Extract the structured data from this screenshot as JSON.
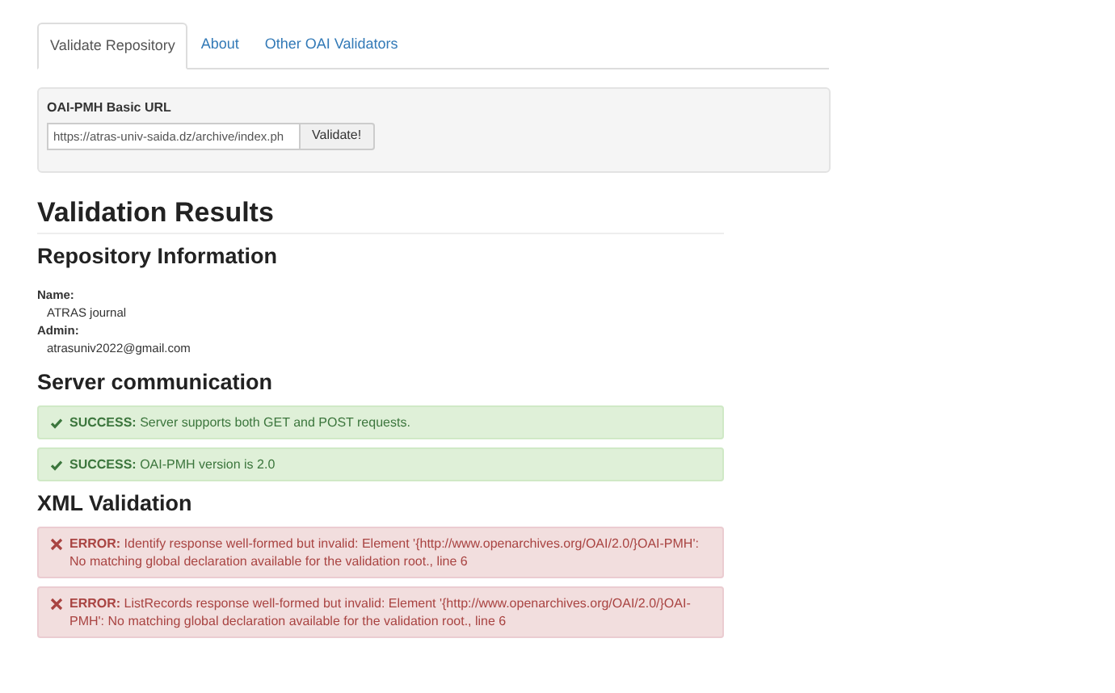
{
  "tabs": [
    {
      "label": "Validate Repository",
      "selected": true
    },
    {
      "label": "About",
      "selected": false
    },
    {
      "label": "Other OAI Validators",
      "selected": false
    }
  ],
  "form": {
    "label": "OAI-PMH Basic URL",
    "value": "https://atras-univ-saida.dz/archive/index.ph",
    "button": "Validate!"
  },
  "title": "Validation Results",
  "sections": [
    {
      "heading": "Repository Information",
      "fields": [
        {
          "label": "Name:",
          "value": "ATRAS journal"
        },
        {
          "label": "Admin:",
          "value": "atrasuniv2022@gmail.com"
        }
      ]
    },
    {
      "heading": "Server communication",
      "alerts": [
        {
          "kind": "success",
          "text": "**SUCCESS:** Server supports both GET and POST requests."
        },
        {
          "kind": "success",
          "text": "**SUCCESS:** OAI-PMH version is 2.0"
        }
      ]
    },
    {
      "heading": "XML Validation",
      "alerts": [
        {
          "kind": "error",
          "text": "**ERROR:** Identify response well-formed but invalid: Element '{http://www.openarchives.org/OAI/2.0/}OAI-PMH': No matching global declaration available for the validation root., line 6"
        },
        {
          "kind": "error",
          "text": "**ERROR:** ListRecords response well-formed but invalid: Element '{http://www.openarchives.org/OAI/2.0/}OAI-PMH': No matching global declaration available for the validation root., line 6"
        }
      ]
    }
  ]
}
